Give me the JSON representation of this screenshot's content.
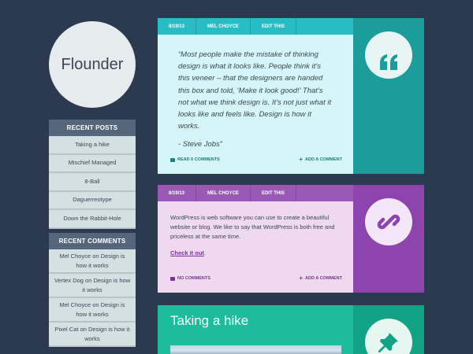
{
  "site": {
    "title": "Flounder"
  },
  "sidebar": {
    "recent_posts": {
      "title": "RECENT POSTS",
      "items": [
        "Taking a hike",
        "Mischief Managed",
        "8-Ball",
        "Daguerreotype",
        "Down the Rabbit-Hole"
      ]
    },
    "recent_comments": {
      "title": "RECENT COMMENTS",
      "items": [
        "Mel Choyce on Design is how it works",
        "Vertex Dog on Design is how it works",
        "Mel Choyce on Design is how it works",
        "Pixel Cat on Design is how it works"
      ]
    }
  },
  "posts": [
    {
      "date": "8/19/13",
      "author": "MEL CHOYCE",
      "edit": "EDIT THIS",
      "quote": "“Most people make the mistake of thinking design is what it looks like. People think it’s this veneer – that the designers are handed this box and told, ‘Make it look good!’ That’s not what we think design is. It’s not just what it looks like and feels like. Design is how it works.",
      "author_line": "- Steve Jobs”",
      "comments": "READ 6 COMMENTS",
      "add_comment": "ADD A COMMENT",
      "icon": "quote-icon",
      "colors": {
        "accent": "#28bcc4",
        "body": "#d6f5f6",
        "side": "#1b9e9b"
      }
    },
    {
      "date": "8/19/13",
      "author": "MEL CHOYCE",
      "edit": "EDIT THIS",
      "text": "WordPress is web software you can use to create a beautiful website or blog. We like to say that WordPress is both free and priceless at the same time.",
      "link": "Check it out",
      "link_suffix": ".",
      "comments": "NO COMMENTS",
      "add_comment": "ADD A COMMENT",
      "icon": "link-icon",
      "colors": {
        "accent": "#9a59b5",
        "body": "#efd9f1",
        "side": "#8e44ad"
      }
    },
    {
      "title": "Taking a hike",
      "icon": "pushpin-icon",
      "colors": {
        "accent": "#1cbc9c",
        "side": "#12a284"
      }
    }
  ]
}
